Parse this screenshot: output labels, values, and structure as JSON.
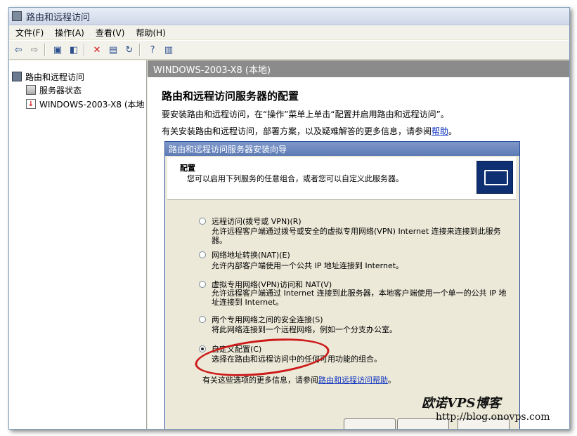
{
  "window": {
    "title": "路由和远程访问"
  },
  "menu": [
    "文件(F)",
    "操作(A)",
    "查看(V)",
    "帮助(H)"
  ],
  "toolbar": [
    "back-arrow-icon",
    "forward-arrow-icon",
    "up-folder-icon",
    "show-tree-icon",
    "delete-icon",
    "properties-icon",
    "refresh-icon",
    "help-icon",
    "console-icon"
  ],
  "tree": {
    "root": "路由和远程访问",
    "status": "服务器状态",
    "server": "WINDOWS-2003-X8 (本地"
  },
  "right": {
    "header": "WINDOWS-2003-X8 (本地)",
    "heading": "路由和远程访问服务器的配置",
    "line1": "要安装路由和远程访问，在“操作”菜单上单击“配置并启用路由和远程访问”。",
    "line2_pre": "有关安装路由和远程访问，部署方案，以及疑难解答的更多信息，请参阅",
    "line2_link": "帮助",
    "line2_post": "。"
  },
  "wizard": {
    "title": "路由和远程访问服务器安装向导",
    "section": "配置",
    "section_desc": "您可以启用下列服务的任意组合，或者您可以自定义此服务器。",
    "options": [
      {
        "label": "远程访问(拨号或 VPN)(R)",
        "desc": "允许远程客户端通过拨号或安全的虚拟专用网络(VPN) Internet 连接来连接到此服务器。",
        "selected": false
      },
      {
        "label": "网络地址转换(NAT)(E)",
        "desc": "允许内部客户端使用一个公共 IP 地址连接到 Internet。",
        "selected": false
      },
      {
        "label": "虚拟专用网络(VPN)访问和 NAT(V)",
        "desc": "允许远程客户端通过 Internet 连接到此服务器，本地客户端使用一个单一的公共 IP 地址连接到 Internet。",
        "selected": false
      },
      {
        "label": "两个专用网络之间的安全连接(S)",
        "desc": "将此网络连接到一个远程网络，例如一个分支办公室。",
        "selected": false
      },
      {
        "label": "自定义配置(C)",
        "desc": "选择在路由和远程访问中的任何可用功能的组合。",
        "selected": true
      }
    ],
    "more_pre": "有关这些选项的更多信息，请参阅",
    "more_link": "路由和远程访问帮助",
    "more_post": "。"
  },
  "watermark": {
    "title": "欧诺VPS博客",
    "url": "http://blog.onovps.com"
  }
}
